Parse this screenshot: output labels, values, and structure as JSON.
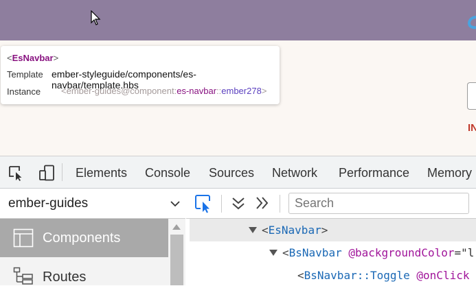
{
  "tooltip": {
    "component_open": "<",
    "component_name": "EsNavbar",
    "component_close": ">",
    "template_label": "Template",
    "template_value": "ember-styleguide/components/es-navbar/template.hbs",
    "instance_label": "Instance",
    "instance_prefix": "<ember-guides@component:",
    "instance_name": "es-navbar",
    "instance_sep": "::",
    "instance_id": "ember278",
    "instance_suffix": ">"
  },
  "page": {
    "partial_red_text": "IN"
  },
  "devtools": {
    "tabs": [
      "Elements",
      "Console",
      "Sources",
      "Network",
      "Performance",
      "Memory"
    ]
  },
  "inspector": {
    "app_select": "ember-guides",
    "nav": {
      "components": "Components",
      "routes": "Routes"
    },
    "search_placeholder": "Search",
    "tree": [
      {
        "open": "<",
        "name": "EsNavbar",
        "close": ">"
      },
      {
        "open": "<",
        "name": "BsNavbar",
        "arg": "@backgroundColor",
        "eq": "=\"l"
      },
      {
        "open": "<",
        "name": "BsNavbar::Toggle",
        "arg": "@onClick"
      }
    ]
  },
  "colors": {
    "header_bg": "#8e7e9e",
    "page_bg": "#fbf7f3",
    "selected_nav": "#a9a9a9",
    "tag": "#1a68b5",
    "arg": "#a0149a"
  }
}
